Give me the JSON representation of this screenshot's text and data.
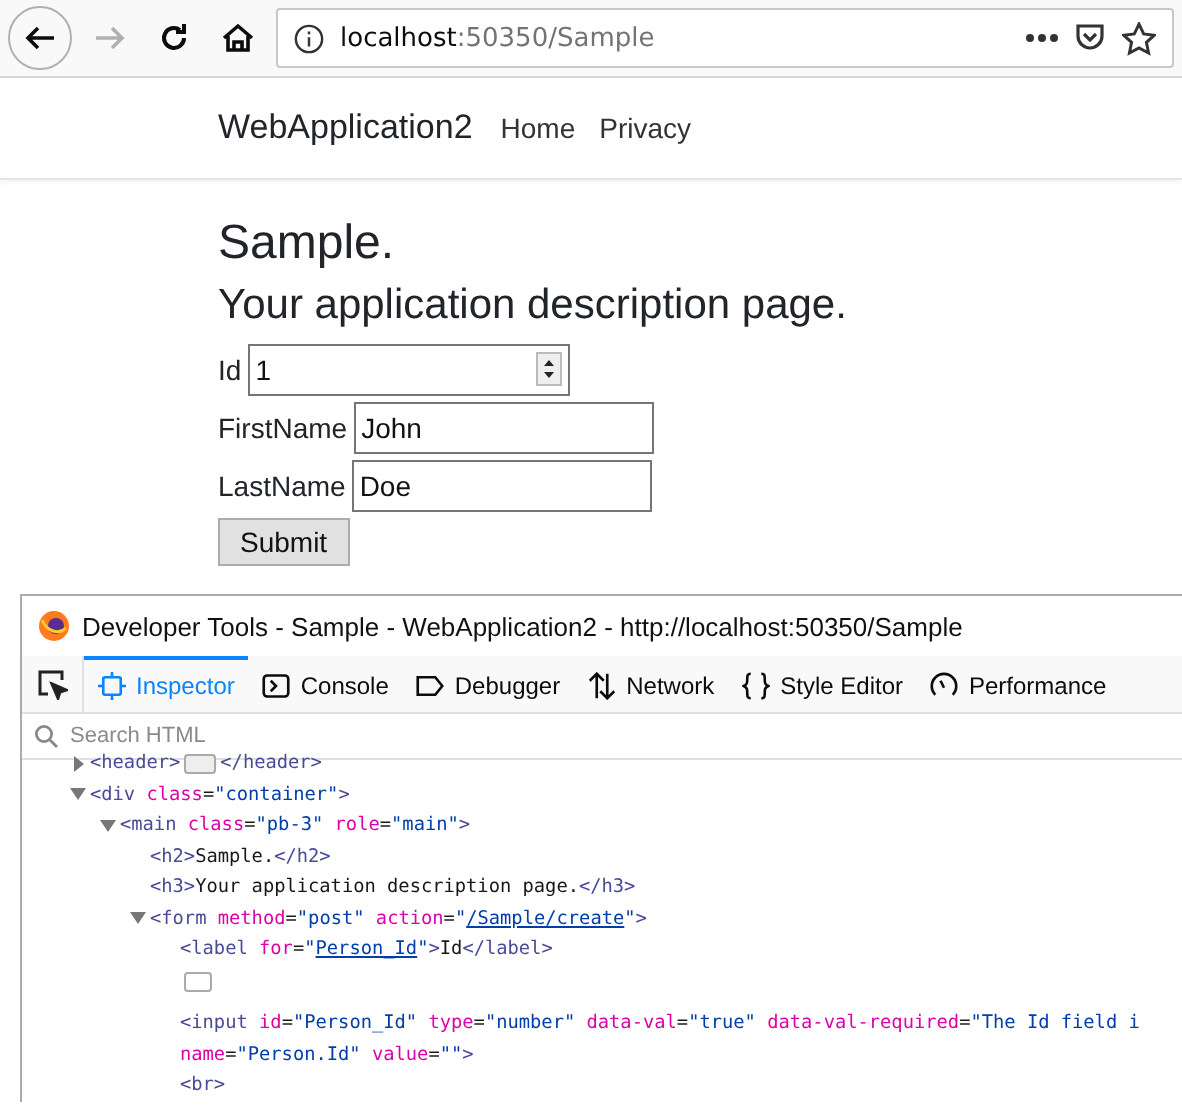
{
  "browser": {
    "url_host": "localhost",
    "url_rest": ":50350/Sample",
    "back_enabled": true,
    "forward_enabled": false
  },
  "site": {
    "brand": "WebApplication2",
    "nav": [
      "Home",
      "Privacy"
    ]
  },
  "page": {
    "title": "Sample.",
    "subtitle": "Your application description page.",
    "fields": [
      {
        "label": "Id",
        "value": "1",
        "kind": "number"
      },
      {
        "label": "FirstName",
        "value": "John",
        "kind": "text"
      },
      {
        "label": "LastName",
        "value": "Doe",
        "kind": "text"
      }
    ],
    "submit": "Submit"
  },
  "devtools": {
    "title": "Developer Tools - Sample - WebApplication2 - http://localhost:50350/Sample",
    "tabs": [
      {
        "label": "Inspector",
        "kind": "inspector",
        "selected": true
      },
      {
        "label": "Console",
        "kind": "console",
        "selected": false
      },
      {
        "label": "Debugger",
        "kind": "debugger",
        "selected": false
      },
      {
        "label": "Network",
        "kind": "network",
        "selected": false
      },
      {
        "label": "Style Editor",
        "kind": "style",
        "selected": false
      },
      {
        "label": "Performance",
        "kind": "performance",
        "selected": false
      }
    ],
    "search": {
      "placeholder": "Search HTML"
    },
    "tree": [
      {
        "kind": "element",
        "expanded": false,
        "lines": [
          [
            {
              "kind": "tag",
              "text": "<header>"
            },
            {
              "kind": "badge"
            },
            {
              "kind": "tag",
              "text": "</header>"
            }
          ]
        ]
      },
      {
        "kind": "element",
        "expanded": true,
        "lines": [
          [
            {
              "kind": "tag",
              "text": "<div"
            },
            {
              "kind": "attr",
              "text": " class"
            },
            {
              "kind": "plain",
              "text": "="
            },
            {
              "kind": "value",
              "text": "\"container\""
            },
            {
              "kind": "tag",
              "text": ">"
            }
          ]
        ],
        "children": [
          {
            "kind": "element",
            "expanded": true,
            "lines": [
              [
                {
                  "kind": "tag",
                  "text": "<main"
                },
                {
                  "kind": "attr",
                  "text": " class"
                },
                {
                  "kind": "plain",
                  "text": "="
                },
                {
                  "kind": "value",
                  "text": "\"pb-3\""
                },
                {
                  "kind": "attr",
                  "text": " role"
                },
                {
                  "kind": "plain",
                  "text": "="
                },
                {
                  "kind": "value",
                  "text": "\"main\""
                },
                {
                  "kind": "tag",
                  "text": ">"
                }
              ]
            ],
            "children": [
              {
                "kind": "leaf",
                "lines": [
                  [
                    {
                      "kind": "tag",
                      "text": "<h2>"
                    },
                    {
                      "kind": "plain",
                      "text": "Sample."
                    },
                    {
                      "kind": "tag",
                      "text": "</h2>"
                    }
                  ]
                ]
              },
              {
                "kind": "leaf",
                "lines": [
                  [
                    {
                      "kind": "tag",
                      "text": "<h3>"
                    },
                    {
                      "kind": "plain",
                      "text": "Your application description page."
                    },
                    {
                      "kind": "tag",
                      "text": "</h3>"
                    }
                  ]
                ]
              },
              {
                "kind": "element",
                "expanded": true,
                "lines": [
                  [
                    {
                      "kind": "tag",
                      "text": "<form"
                    },
                    {
                      "kind": "attr",
                      "text": " method"
                    },
                    {
                      "kind": "plain",
                      "text": "="
                    },
                    {
                      "kind": "value",
                      "text": "\"post\""
                    },
                    {
                      "kind": "attr",
                      "text": " action"
                    },
                    {
                      "kind": "plain",
                      "text": "="
                    },
                    {
                      "kind": "value",
                      "text": "\""
                    },
                    {
                      "kind": "link",
                      "text": "/Sample/create"
                    },
                    {
                      "kind": "value",
                      "text": "\""
                    },
                    {
                      "kind": "tag",
                      "text": ">"
                    }
                  ]
                ],
                "children": [
                  {
                    "kind": "leaf",
                    "lines": [
                      [
                        {
                          "kind": "tag",
                          "text": "<label"
                        },
                        {
                          "kind": "attr",
                          "text": " for"
                        },
                        {
                          "kind": "plain",
                          "text": "="
                        },
                        {
                          "kind": "value",
                          "text": "\""
                        },
                        {
                          "kind": "link",
                          "text": "Person_Id"
                        },
                        {
                          "kind": "value",
                          "text": "\""
                        },
                        {
                          "kind": "tag",
                          "text": ">"
                        },
                        {
                          "kind": "plain",
                          "text": "Id"
                        },
                        {
                          "kind": "tag",
                          "text": "</label>"
                        }
                      ]
                    ]
                  },
                  {
                    "kind": "whitespace"
                  },
                  {
                    "kind": "leaf",
                    "lines": [
                      [
                        {
                          "kind": "tag",
                          "text": "<input"
                        },
                        {
                          "kind": "attr",
                          "text": " id"
                        },
                        {
                          "kind": "plain",
                          "text": "="
                        },
                        {
                          "kind": "value",
                          "text": "\"Person_Id\""
                        },
                        {
                          "kind": "attr",
                          "text": " type"
                        },
                        {
                          "kind": "plain",
                          "text": "="
                        },
                        {
                          "kind": "value",
                          "text": "\"number\""
                        },
                        {
                          "kind": "attr",
                          "text": " data-val"
                        },
                        {
                          "kind": "plain",
                          "text": "="
                        },
                        {
                          "kind": "value",
                          "text": "\"true\""
                        },
                        {
                          "kind": "attr",
                          "text": " data-val-required"
                        },
                        {
                          "kind": "plain",
                          "text": "="
                        },
                        {
                          "kind": "value",
                          "text": "\"The Id field i"
                        }
                      ],
                      [
                        {
                          "kind": "attr",
                          "text": "name"
                        },
                        {
                          "kind": "plain",
                          "text": "="
                        },
                        {
                          "kind": "value",
                          "text": "\"Person.Id\""
                        },
                        {
                          "kind": "attr",
                          "text": " value"
                        },
                        {
                          "kind": "plain",
                          "text": "="
                        },
                        {
                          "kind": "value",
                          "text": "\"\""
                        },
                        {
                          "kind": "tag",
                          "text": ">"
                        }
                      ]
                    ]
                  },
                  {
                    "kind": "leaf",
                    "lines": [
                      [
                        {
                          "kind": "tag",
                          "text": "<br>"
                        }
                      ]
                    ]
                  }
                ]
              }
            ]
          }
        ]
      }
    ]
  }
}
